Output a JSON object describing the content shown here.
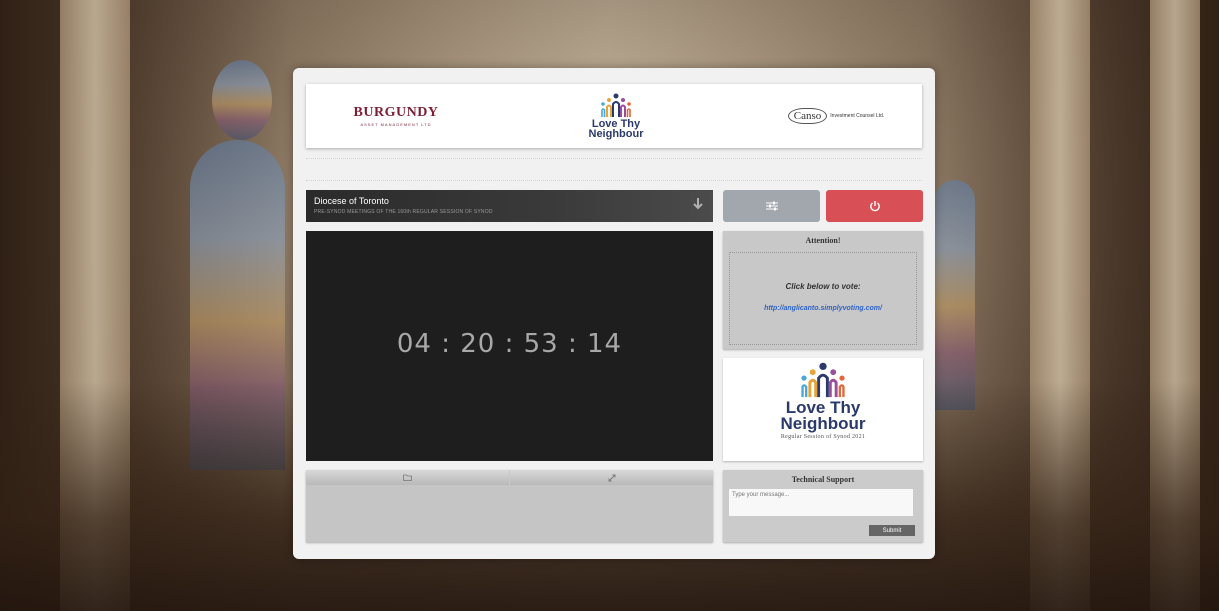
{
  "sponsors": {
    "burgundy_name": "BURGUNDY",
    "burgundy_sub": "ASSET MANAGEMENT LTD",
    "ltn_line1": "Love Thy",
    "ltn_line2": "Neighbour",
    "canso_name": "Canso",
    "canso_sub": "Investment Counsel Ltd."
  },
  "stream": {
    "title": "Diocese of Toronto",
    "subtitle": "PRE-SYNOD MEETINGS OF THE 160th REGULAR SESSION OF SYNOD",
    "download_icon": "download-arrow-icon",
    "countdown": "04 : 20 : 53 : 14"
  },
  "controls": {
    "settings_icon": "sliders-icon",
    "power_icon": "power-icon",
    "power_color": "#d94f56",
    "settings_color": "#a2a6ad"
  },
  "attention": {
    "heading": "Attention!",
    "message": "Click below to vote:",
    "link": "http://anglicanto.simplyvoting.com/"
  },
  "ltn_card": {
    "line1": "Love Thy",
    "line2": "Neighbour",
    "subtitle": "Regular Session of Synod 2021"
  },
  "chat": {
    "tab1_icon": "folder-icon",
    "tab2_icon": "expand-icon"
  },
  "support": {
    "heading": "Technical Support",
    "placeholder": "Type your message...",
    "submit_label": "Submit"
  }
}
